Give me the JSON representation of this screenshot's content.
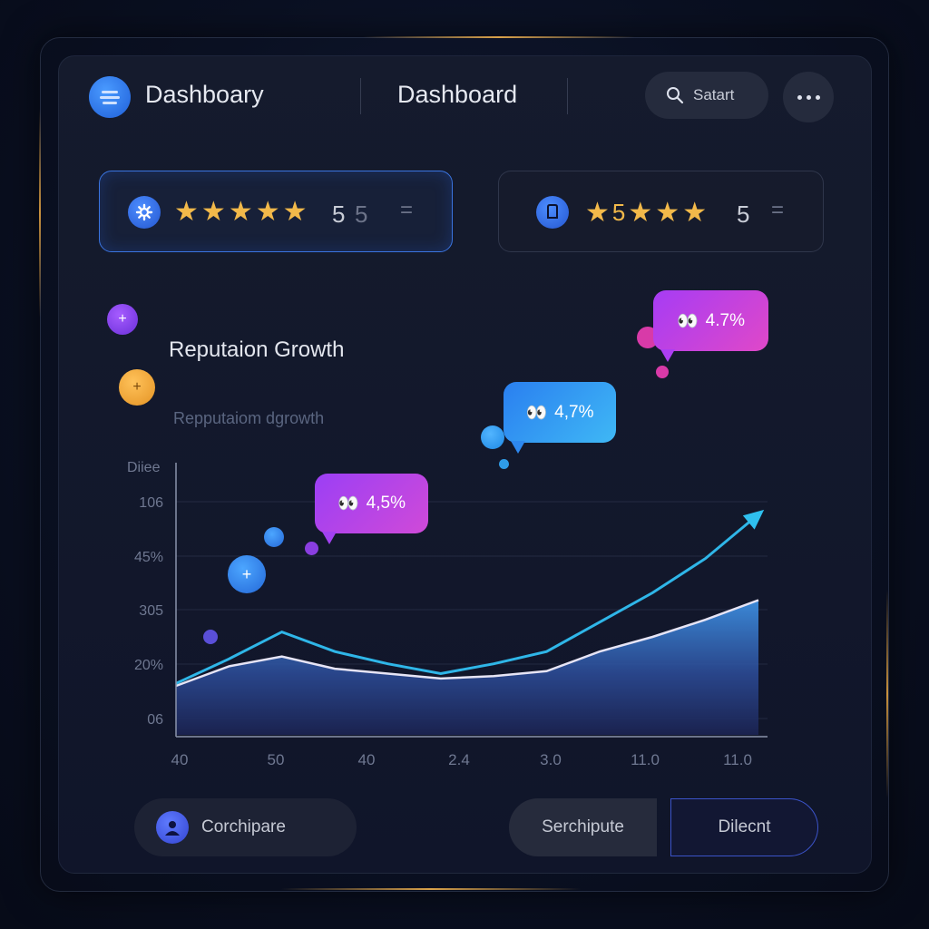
{
  "header": {
    "app_title": "Dashboary",
    "center_title": "Dashboard",
    "search_label": "Satart"
  },
  "ratings": [
    {
      "stars": 5,
      "value": "5",
      "value_dim": "5",
      "icon": "gear-icon"
    },
    {
      "stars": 5,
      "value_leading": "5",
      "value": "5",
      "icon": "shield-icon"
    }
  ],
  "section": {
    "title": "Reputaion Growth",
    "subtitle": "Repputaiom dgrowth"
  },
  "bubbles": [
    {
      "label": "4,5%",
      "icon": "emoji-eyes-icon"
    },
    {
      "label": "4,7%",
      "icon": "emoji-eyes-icon"
    },
    {
      "label": "4.7%",
      "icon": "emoji-eyes-icon"
    }
  ],
  "chart_data": {
    "type": "area",
    "ylabel": "Diiee",
    "y_ticks": [
      "106",
      "45%",
      "305",
      "20%",
      "06"
    ],
    "x_ticks": [
      "40",
      "50",
      "40",
      "2.4",
      "3.0",
      "11.0",
      "11.0"
    ],
    "series": [
      {
        "values": [
          20,
          28,
          32,
          27,
          25,
          23,
          24,
          26,
          34,
          40,
          47,
          55
        ]
      },
      {
        "values": [
          21,
          31,
          42,
          34,
          29,
          25,
          29,
          34,
          46,
          58,
          72,
          90
        ]
      }
    ],
    "ylim": [
      0,
      100
    ]
  },
  "footer": {
    "compare_label": "Corchipare",
    "compute_label": "Serchipute",
    "silent_label": "Dilecnt"
  },
  "colors": {
    "accent": "#3a74e0",
    "line_cyan": "#2fb6e8",
    "star_gold": "#f2b94a",
    "bubble_purple": "#a83cf0",
    "bubble_blue": "#2a8cf0"
  }
}
